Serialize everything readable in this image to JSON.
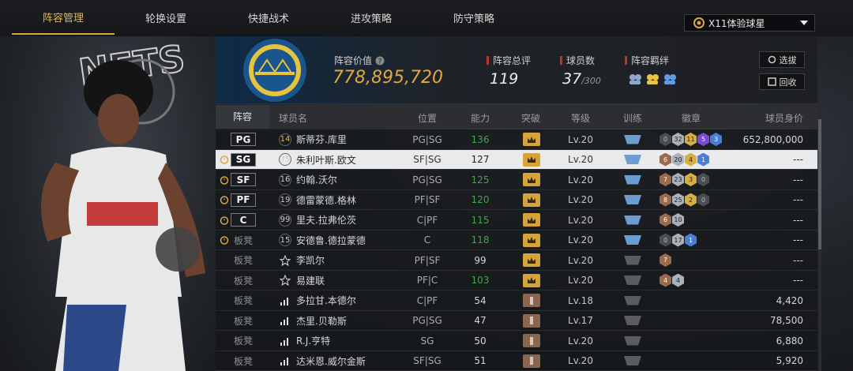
{
  "tabs": [
    "阵容管理",
    "轮换设置",
    "快捷战术",
    "进攻策略",
    "防守策略"
  ],
  "mode_select": {
    "value": "X11体验球星"
  },
  "header": {
    "value_label": "阵容价值",
    "value": "778,895,720",
    "rating_label": "阵容总评",
    "rating": "119",
    "count_label": "球员数",
    "count": "37",
    "count_max": "/300",
    "bond_label": "阵容羁绊",
    "btn_select": "选拔",
    "btn_recycle": "回收"
  },
  "columns": [
    "阵容",
    "球员名",
    "位置",
    "能力",
    "突破",
    "等级",
    "训练",
    "徽章",
    "球员身价"
  ],
  "rows": [
    {
      "slot": "PG",
      "num": "14",
      "name": "斯蒂芬.库里",
      "pos": "PG|SG",
      "ability": "136",
      "level": "Lv.20",
      "badges": [
        "0",
        "32",
        "11",
        "5",
        "3"
      ],
      "value": "652,800,000"
    },
    {
      "slot": "SG",
      "num": "75",
      "name": "朱利叶斯.欧文",
      "pos": "SF|SG",
      "ability": "127",
      "level": "Lv.20",
      "badges": [
        "6",
        "20",
        "4",
        "1"
      ],
      "value": "---"
    },
    {
      "slot": "SF",
      "num": "16",
      "name": "约翰.沃尔",
      "pos": "PG|SG",
      "ability": "125",
      "level": "Lv.20",
      "badges": [
        "7",
        "23",
        "3",
        "0"
      ],
      "value": "---"
    },
    {
      "slot": "PF",
      "num": "19",
      "name": "德雷蒙德.格林",
      "pos": "PF|SF",
      "ability": "120",
      "level": "Lv.20",
      "badges": [
        "8",
        "25",
        "2",
        "0"
      ],
      "value": "---"
    },
    {
      "slot": "C",
      "num": "99",
      "name": "里夫.拉弗伦茨",
      "pos": "C|PF",
      "ability": "115",
      "level": "Lv.20",
      "badges": [
        "6",
        "10"
      ],
      "value": "---"
    },
    {
      "slot": "板凳",
      "num": "15",
      "name": "安德鲁.德拉蒙德",
      "pos": "C",
      "ability": "118",
      "level": "Lv.20",
      "badges": [
        "0",
        "17",
        "1"
      ],
      "value": "---"
    },
    {
      "slot": "板凳",
      "num": "☆",
      "name": "李凯尔",
      "pos": "PF|SF",
      "ability": "99",
      "level": "Lv.20",
      "badges": [
        "7"
      ],
      "value": "---"
    },
    {
      "slot": "板凳",
      "num": "☆",
      "name": "易建联",
      "pos": "PF|C",
      "ability": "103",
      "level": "Lv.20",
      "badges": [
        "4",
        "4"
      ],
      "value": "---"
    },
    {
      "slot": "板凳",
      "num": "▮",
      "name": "多拉甘.本德尔",
      "pos": "C|PF",
      "ability": "54",
      "level": "Lv.18",
      "badges": [],
      "value": "4,420"
    },
    {
      "slot": "板凳",
      "num": "▮",
      "name": "杰里.贝勒斯",
      "pos": "PG|SG",
      "ability": "47",
      "level": "Lv.17",
      "badges": [],
      "value": "78,500"
    },
    {
      "slot": "板凳",
      "num": "▮",
      "name": "R.J.亨特",
      "pos": "SG",
      "ability": "50",
      "level": "Lv.20",
      "badges": [],
      "value": "6,880"
    },
    {
      "slot": "板凳",
      "num": "▮",
      "name": "达米恩.威尔金斯",
      "pos": "SF|SG",
      "ability": "51",
      "level": "Lv.20",
      "badges": [],
      "value": "5,920"
    }
  ],
  "colors": {
    "accent": "#e2a83b",
    "ability_green": "#3fa64a",
    "red_marker": "#c0332b"
  }
}
